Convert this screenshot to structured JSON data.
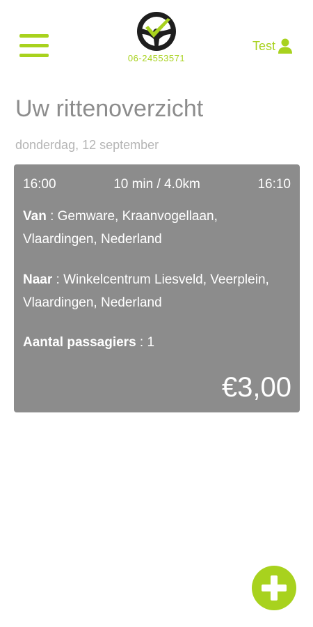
{
  "header": {
    "phone": "06-24553571",
    "user_label": "Test",
    "menu_icon": "hamburger-icon",
    "logo_icon": "steering-wheel-icon",
    "user_icon": "user-icon"
  },
  "page": {
    "title": "Uw rittenoverzicht",
    "date": "donderdag, 12 september"
  },
  "rides": [
    {
      "start_time": "16:00",
      "duration_distance": "10 min / 4.0km",
      "end_time": "16:10",
      "from_label": "Van",
      "from_value": "Gemware, Kraanvogellaan, Vlaardingen, Nederland",
      "to_label": "Naar",
      "to_value": "Winkelcentrum Liesveld, Veerplein, Vlaardingen, Nederland",
      "passengers_label": "Aantal passagiers",
      "passengers_value": "1",
      "price": "€3,00"
    }
  ],
  "fab": {
    "icon": "plus-icon"
  },
  "colors": {
    "accent": "#a8d21e",
    "card": "#8c8c8c",
    "title": "#8c8c8c",
    "date": "#b5b5b5"
  }
}
